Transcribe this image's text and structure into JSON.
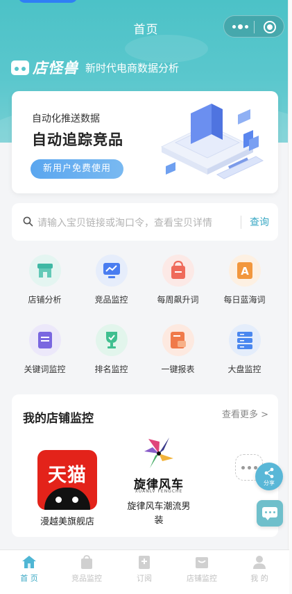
{
  "nav": {
    "title": "首页"
  },
  "brand": {
    "name": "店怪兽",
    "slogan": "新时代电商数据分析"
  },
  "banner": {
    "subtitle": "自动化推送数据",
    "title": "自动追踪竞品",
    "cta": "新用户免费使用"
  },
  "search": {
    "placeholder": "请输入宝贝链接或淘口令，查看宝贝详情",
    "button": "查询"
  },
  "features": [
    {
      "label": "店铺分析",
      "icon": "shop-icon",
      "color": "#3fb8a4",
      "bg": "#e4f5f1"
    },
    {
      "label": "竞品监控",
      "icon": "monitor-chart-icon",
      "color": "#4a7df0",
      "bg": "#e6edfb"
    },
    {
      "label": "每周飙升词",
      "icon": "shopping-bag-icon",
      "color": "#ef6a5a",
      "bg": "#fce9e6"
    },
    {
      "label": "每日蓝海词",
      "icon": "letter-a-icon",
      "color": "#f2973d",
      "bg": "#fdf0e2"
    },
    {
      "label": "关键词监控",
      "icon": "book-icon",
      "color": "#7a67e0",
      "bg": "#ece8fa"
    },
    {
      "label": "排名监控",
      "icon": "trophy-icon",
      "color": "#3fbf8f",
      "bg": "#e2f5ec"
    },
    {
      "label": "一键报表",
      "icon": "report-icon",
      "color": "#f07a4a",
      "bg": "#fde9e0"
    },
    {
      "label": "大盘监控",
      "icon": "server-icon",
      "color": "#4a87ef",
      "bg": "#e4edfb"
    }
  ],
  "monitor": {
    "title": "我的店铺监控",
    "more": "查看更多 >",
    "shops": [
      {
        "name": "漫越美旗舰店",
        "logo_text": "天猫"
      },
      {
        "name_line1": "旋律风车潮流男",
        "name_line2": "装",
        "logo_text": "旋律风车",
        "logo_sub": "XUANLV FENGCHE"
      }
    ]
  },
  "float": {
    "share_label": "分享"
  },
  "tabbar": [
    {
      "label": "首 页",
      "icon": "home-icon",
      "active": true
    },
    {
      "label": "竞品监控",
      "icon": "bag-icon",
      "active": false
    },
    {
      "label": "订阅",
      "icon": "subscribe-icon",
      "active": false
    },
    {
      "label": "店铺监控",
      "icon": "store-icon",
      "active": false
    },
    {
      "label": "我 的",
      "icon": "user-icon",
      "active": false
    }
  ],
  "colors": {
    "accent": "#3aa8c4",
    "header": "#4cc2c7",
    "cta": "#5aa6ef",
    "tmall": "#e3231a"
  }
}
